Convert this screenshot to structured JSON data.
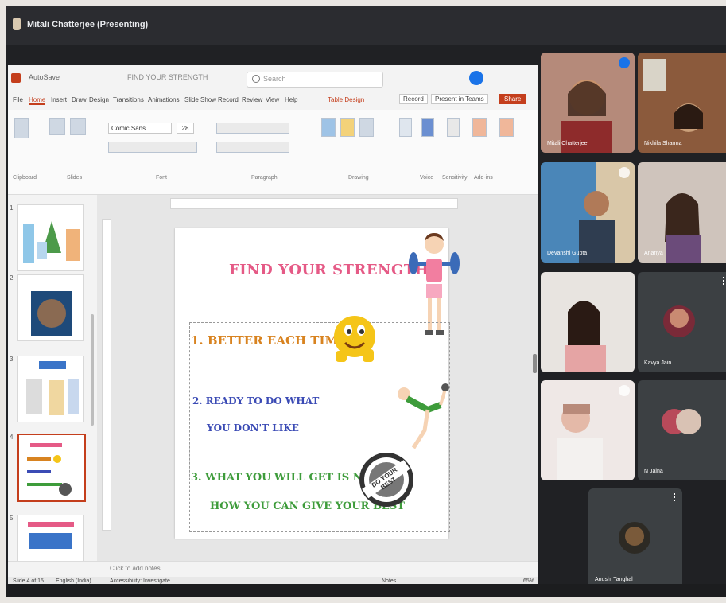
{
  "presenter": {
    "label": "Mitali Chatterjee (Presenting)"
  },
  "ppt": {
    "autosave": "AutoSave",
    "doc_title": "FIND YOUR STRENGTH",
    "search_placeholder": "Search",
    "menu_tabs": [
      "File",
      "Home",
      "Insert",
      "Draw",
      "Design",
      "Transitions",
      "Animations",
      "Slide Show",
      "Record",
      "Review",
      "View",
      "Help",
      "Table Design"
    ],
    "active_tab": "Home",
    "record_label": "Record",
    "present_label": "Present in Teams",
    "share_label": "Share",
    "font_name": "Comic Sans",
    "font_size": "28",
    "ribbon_groups": [
      "Clipboard",
      "Slides",
      "Font",
      "Paragraph",
      "Drawing",
      "Voice",
      "Sensitivity",
      "Add-ins"
    ],
    "notes_placeholder": "Click to add notes",
    "status": {
      "slide_info": "Slide 4 of 15",
      "language": "English (India)",
      "accessibility": "Accessibility: Investigate",
      "notes": "Notes",
      "zoom": "65%"
    }
  },
  "slide": {
    "title": "FIND YOUR STRENGTH",
    "point1": "1.  BETTER EACH TIME",
    "point2_line1": "2. READY TO DO WHAT",
    "point2_line2": "YOU DON'T LIKE",
    "point3_line1": "3. WHAT YOU WILL GET IS NOT IMP",
    "point3_line2": "HOW YOU CAN GIVE YOUR BEST",
    "stamp": "DO YOUR BEST"
  },
  "participants": [
    {
      "name": "Mitali Chatterjee"
    },
    {
      "name": "Nikhila Sharma"
    },
    {
      "name": "Devanshi Gupta"
    },
    {
      "name": "Ananya"
    },
    {
      "name": ""
    },
    {
      "name": "Kavya Jain"
    },
    {
      "name": ""
    },
    {
      "name": "N Jaina"
    },
    {
      "name": "Anushi Tanghal"
    }
  ],
  "colors": {
    "ppt_accent": "#c43e1c",
    "meet_bg": "#202124",
    "tile_bg": "#3c4043",
    "title_pink": "#e55a86"
  }
}
